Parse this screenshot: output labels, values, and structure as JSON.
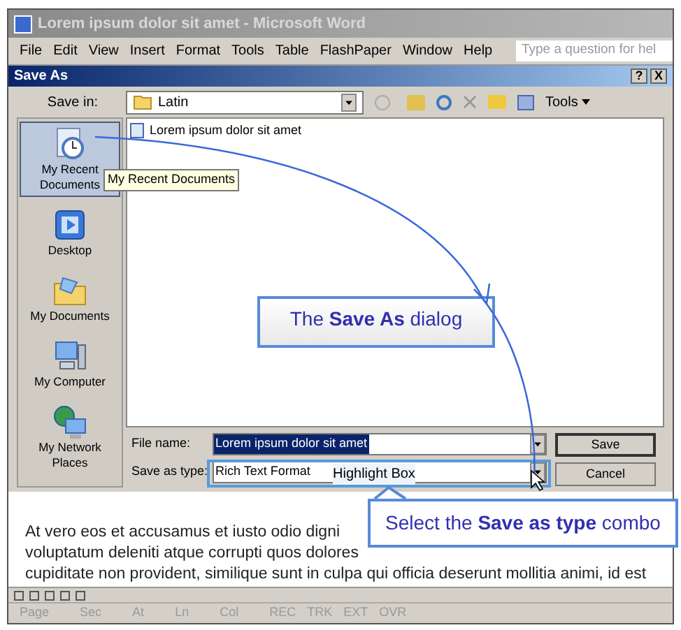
{
  "window": {
    "title": "Lorem ipsum dolor sit amet - Microsoft Word"
  },
  "menu": [
    "File",
    "Edit",
    "View",
    "Insert",
    "Format",
    "Tools",
    "Table",
    "FlashPaper",
    "Window",
    "Help"
  ],
  "help_search": {
    "placeholder": "Type a question for hel"
  },
  "dialog": {
    "title": "Save As",
    "help_button": "?",
    "close_button": "X",
    "save_in": {
      "label": "Save in:",
      "value": "Latin"
    },
    "tools_label": "Tools",
    "places": [
      {
        "label": "My Recent Documents",
        "selected": true
      },
      {
        "label": "Desktop",
        "selected": false
      },
      {
        "label": "My Documents",
        "selected": false
      },
      {
        "label": "My Computer",
        "selected": false
      },
      {
        "label": "My Network Places",
        "selected": false
      }
    ],
    "files": [
      "Lorem ipsum dolor sit amet"
    ],
    "tooltip": "My Recent Documents",
    "file_name": {
      "label": "File name:",
      "value": "Lorem ipsum dolor sit amet"
    },
    "save_as_type": {
      "label": "Save as type:",
      "value": "Rich Text Format"
    },
    "buttons": [
      "Save",
      "Cancel"
    ]
  },
  "document": {
    "lines": [
      "At vero eos et accusamus et iusto odio digni",
      "voluptatum deleniti atque corrupti quos dolores",
      "cupiditate non provident, similique sunt in culpa qui officia deserunt mollitia animi, id est"
    ]
  },
  "status_bar": [
    "Page",
    "Sec",
    "At",
    "Ln",
    "Col",
    "REC",
    "TRK",
    "EXT",
    "OVR"
  ],
  "annotations": {
    "dialog_callout": "The **Save As** dialog",
    "highlight_label": "Highlight Box",
    "type_callout": "Select the **Save as type** combo"
  }
}
